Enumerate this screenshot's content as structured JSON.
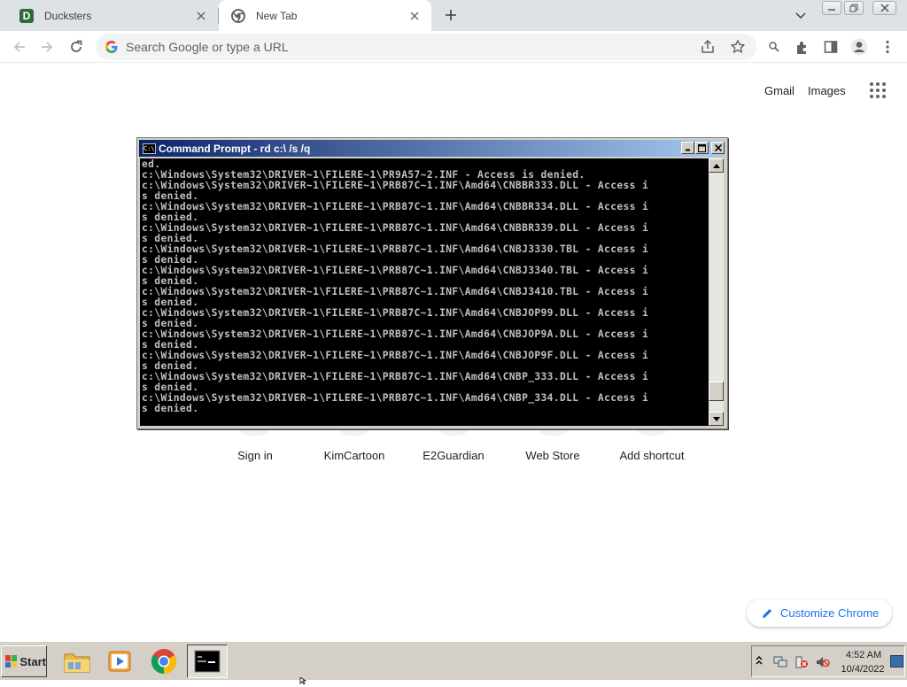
{
  "browser": {
    "tabs": [
      {
        "title": "Ducksters",
        "favicon": "ducksters-d-icon",
        "active": false
      },
      {
        "title": "New Tab",
        "favicon": "chrome-icon",
        "active": true
      }
    ],
    "omnibox_placeholder": "Search Google or type a URL",
    "toolbar_icons": [
      "back-icon",
      "forward-icon",
      "reload-icon",
      "share-icon",
      "star-icon",
      "lens-icon",
      "extensions-icon",
      "side-panel-icon",
      "profile-icon",
      "menu-icon"
    ]
  },
  "ntp": {
    "top_links": {
      "gmail": "Gmail",
      "images": "Images"
    },
    "shortcuts": [
      {
        "label": "Sign in"
      },
      {
        "label": "KimCartoon"
      },
      {
        "label": "E2Guardian"
      },
      {
        "label": "Web Store"
      },
      {
        "label": "Add shortcut"
      }
    ],
    "customize_label": "Customize Chrome"
  },
  "cmd": {
    "title": "Command Prompt - rd c:\\ /s /q",
    "lines": [
      "ed.",
      "c:\\Windows\\System32\\DRIVER~1\\FILERE~1\\PR9A57~2.INF - Access is denied.",
      "c:\\Windows\\System32\\DRIVER~1\\FILERE~1\\PRB87C~1.INF\\Amd64\\CNBBR333.DLL - Access i",
      "s denied.",
      "c:\\Windows\\System32\\DRIVER~1\\FILERE~1\\PRB87C~1.INF\\Amd64\\CNBBR334.DLL - Access i",
      "s denied.",
      "c:\\Windows\\System32\\DRIVER~1\\FILERE~1\\PRB87C~1.INF\\Amd64\\CNBBR339.DLL - Access i",
      "s denied.",
      "c:\\Windows\\System32\\DRIVER~1\\FILERE~1\\PRB87C~1.INF\\Amd64\\CNBJ3330.TBL - Access i",
      "s denied.",
      "c:\\Windows\\System32\\DRIVER~1\\FILERE~1\\PRB87C~1.INF\\Amd64\\CNBJ3340.TBL - Access i",
      "s denied.",
      "c:\\Windows\\System32\\DRIVER~1\\FILERE~1\\PRB87C~1.INF\\Amd64\\CNBJ3410.TBL - Access i",
      "s denied.",
      "c:\\Windows\\System32\\DRIVER~1\\FILERE~1\\PRB87C~1.INF\\Amd64\\CNBJOP99.DLL - Access i",
      "s denied.",
      "c:\\Windows\\System32\\DRIVER~1\\FILERE~1\\PRB87C~1.INF\\Amd64\\CNBJOP9A.DLL - Access i",
      "s denied.",
      "c:\\Windows\\System32\\DRIVER~1\\FILERE~1\\PRB87C~1.INF\\Amd64\\CNBJOP9F.DLL - Access i",
      "s denied.",
      "c:\\Windows\\System32\\DRIVER~1\\FILERE~1\\PRB87C~1.INF\\Amd64\\CNBP_333.DLL - Access i",
      "s denied.",
      "c:\\Windows\\System32\\DRIVER~1\\FILERE~1\\PRB87C~1.INF\\Amd64\\CNBP_334.DLL - Access i",
      "s denied."
    ],
    "scroll_position": 0.95
  },
  "taskbar": {
    "start_label": "Start",
    "apps": [
      "file-explorer-icon",
      "media-player-icon",
      "chrome-icon",
      "command-prompt-icon"
    ],
    "tray_icons": [
      "show-hidden-icons-icon",
      "network-icon",
      "security-alert-icon",
      "volume-muted-icon"
    ],
    "clock": {
      "time": "4:52 AM",
      "date": "10/4/2022"
    }
  }
}
